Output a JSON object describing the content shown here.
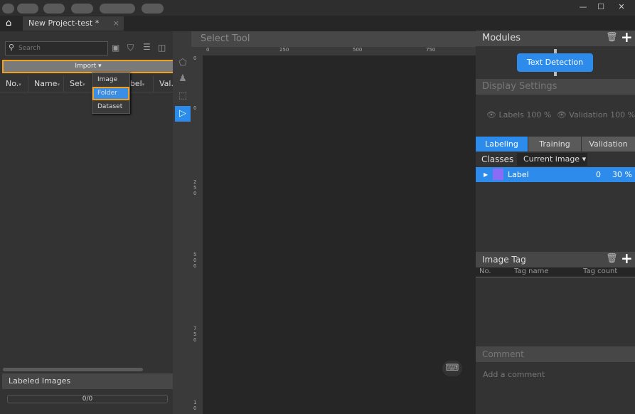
{
  "titlebar": {
    "controls": [
      "minimize-icon",
      "maximize-icon",
      "close-icon"
    ]
  },
  "tabs": [
    {
      "label": "New Project-test *",
      "close": "×"
    }
  ],
  "left": {
    "search_placeholder": "Search",
    "import_label": "Import",
    "import_menu": [
      "Image",
      "Folder",
      "Dataset"
    ],
    "selected_menu_item": "Folder",
    "columns": [
      "No.",
      "Name",
      "Set",
      "Label",
      "Val."
    ],
    "labeled_images_title": "Labeled Images",
    "labeled_progress": "0/0",
    "labeled_fraction": 0
  },
  "canvas": {
    "tool_title": "Select Tool",
    "hruler_ticks": [
      "0",
      "250",
      "500",
      "750"
    ],
    "vruler_ticks": [
      "0",
      "0",
      "250",
      "500",
      "750",
      "10"
    ]
  },
  "right": {
    "modules_title": "Modules",
    "module_node": "Text Detection",
    "display_title": "Display Settings",
    "labels_text": "Labels",
    "labels_value": "100 %",
    "validation_text": "Validation",
    "validation_value": "100 %",
    "tabs": [
      "Labeling",
      "Training",
      "Validation"
    ],
    "active_tab": "Labeling",
    "classes_label": "Classes",
    "classes_filter": "Current image",
    "class_rows": [
      {
        "name": "Label",
        "count": "0",
        "percent": "30 %",
        "color": "#8b6cf6"
      }
    ],
    "image_tag_title": "Image Tag",
    "tag_columns": [
      "No.",
      "Tag name",
      "Tag count"
    ],
    "comment_title": "Comment",
    "comment_placeholder": "Add a comment"
  },
  "colors": {
    "accent": "#2d8ceb",
    "highlight": "#f0a020"
  }
}
